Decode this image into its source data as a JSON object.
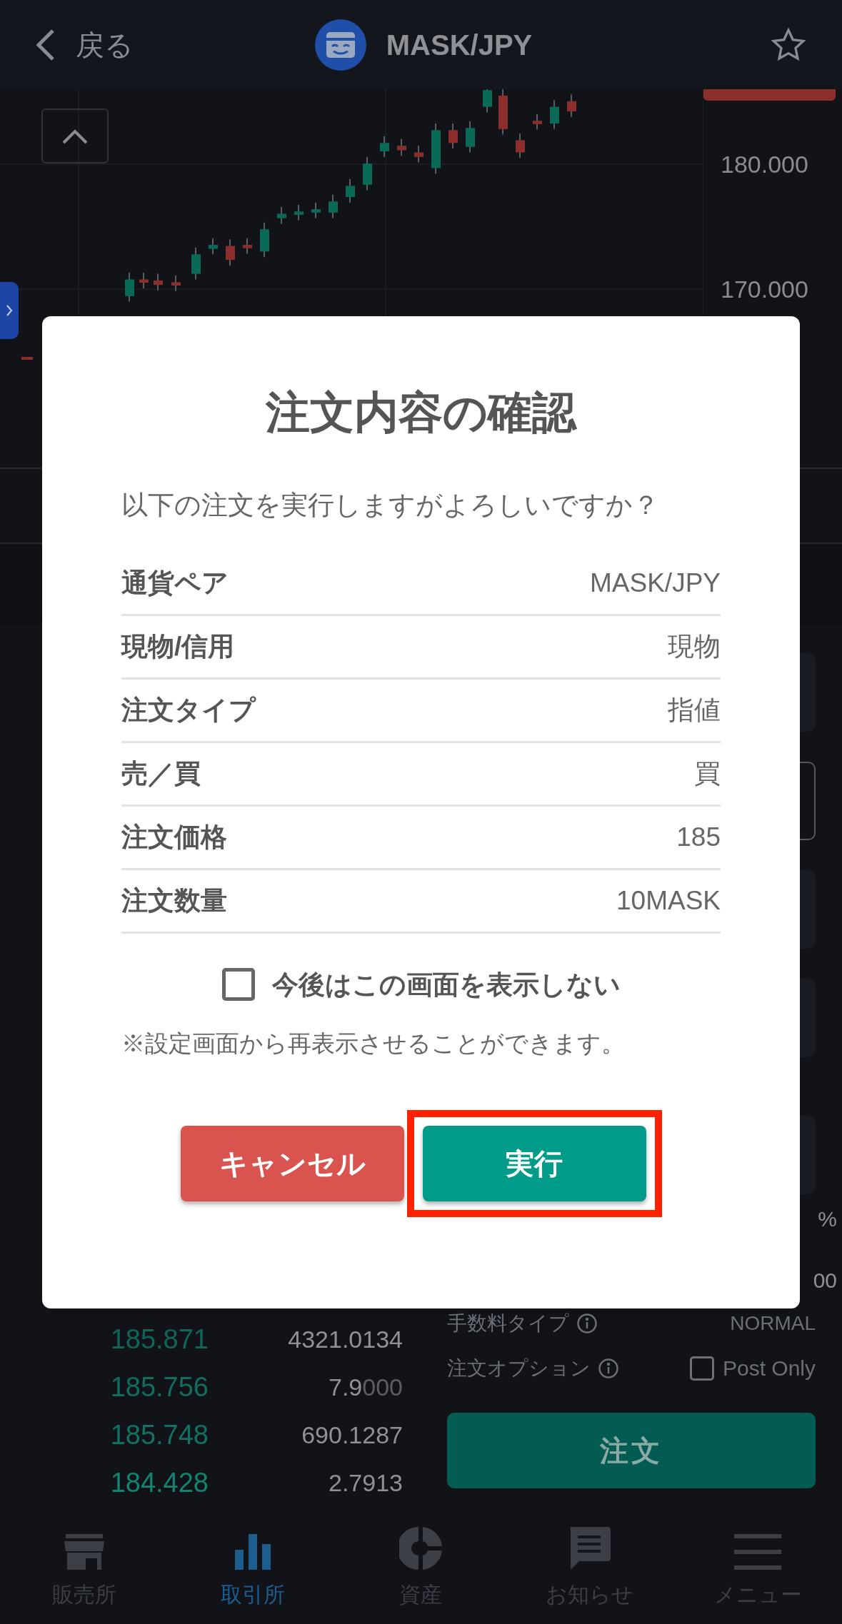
{
  "header": {
    "back_label": "戻る",
    "title": "MASK/JPY",
    "favorite": false
  },
  "chart": {
    "price_axis": [
      "180.000",
      "170.000"
    ]
  },
  "right_panel": {
    "fragments": [
      "%",
      "00"
    ]
  },
  "order_book": [
    {
      "price": "185.871",
      "amount": "4321.0134"
    },
    {
      "price": "185.756",
      "amount": "7.9",
      "amount_faded": "000"
    },
    {
      "price": "185.748",
      "amount": "690.1287"
    },
    {
      "price": "184.428",
      "amount": "2.7913"
    }
  ],
  "order_form": {
    "fee_label": "手数料タイプ",
    "fee_value": "NORMAL",
    "option_label": "注文オプション",
    "post_only": {
      "label": "Post Only",
      "checked": false
    },
    "submit": "注文"
  },
  "dialog": {
    "title": "注文内容の確認",
    "message": "以下の注文を実行しますがよろしいですか？",
    "rows": [
      {
        "label": "通貨ペア",
        "value": "MASK/JPY"
      },
      {
        "label": "現物/信用",
        "value": "現物"
      },
      {
        "label": "注文タイプ",
        "value": "指値"
      },
      {
        "label": "売／買",
        "value": "買"
      },
      {
        "label": "注文価格",
        "value": "185"
      },
      {
        "label": "注文数量",
        "value": "10MASK"
      }
    ],
    "dont_show": {
      "label": "今後はこの画面を表示しない",
      "checked": false
    },
    "note": "※設定画面から再表示させることができます。",
    "cancel": "キャンセル",
    "confirm": "実行",
    "confirm_highlighted": true
  },
  "tab_bar": [
    {
      "kind": "store",
      "label": "販売所",
      "selected": false
    },
    {
      "kind": "exchange",
      "label": "取引所",
      "selected": true
    },
    {
      "kind": "assets",
      "label": "資産",
      "selected": false
    },
    {
      "kind": "news",
      "label": "お知らせ",
      "selected": false
    },
    {
      "kind": "menu",
      "label": "メニュー",
      "selected": false
    }
  ]
}
